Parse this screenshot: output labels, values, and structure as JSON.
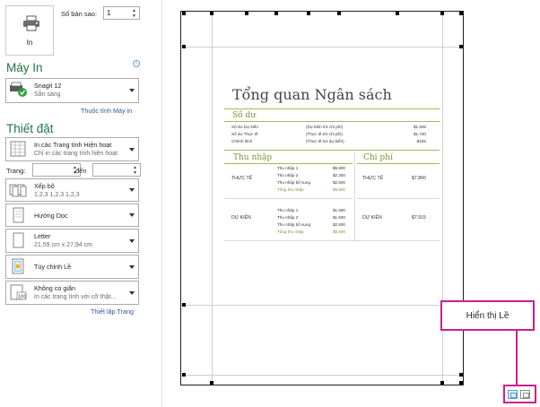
{
  "print": {
    "button_label": "In",
    "copies_label": "Số bản sao:",
    "copies_value": "1"
  },
  "printer": {
    "section_title": "Máy In",
    "info_glyph": "i",
    "name": "Snagit 12",
    "status": "Sẵn sàng",
    "properties_link": "Thuộc tính Máy in"
  },
  "settings": {
    "section_title": "Thiết đặt",
    "scope": {
      "main": "In các Trang tính Hiện hoạt",
      "sub": "Chỉ in các trang tính hiện hoạt"
    },
    "pages_label": "Trang:",
    "to_label": "đến",
    "collate": {
      "main": "Xếp bộ",
      "sub": "1,2,3    1,2,3    1,2,3"
    },
    "orientation": {
      "main": "Hướng Dọc"
    },
    "paper": {
      "main": "Letter",
      "sub": "21,59 cm x 27,94 cm"
    },
    "margins": {
      "main": "Tùy chỉnh Lề"
    },
    "scaling": {
      "main": "Không co giãn",
      "sub": "In các trang tính với cỡ thật..."
    },
    "page_setup_link": "Thiết lập Trang"
  },
  "document": {
    "title": "Tổng quan Ngân sách",
    "balance": {
      "heading": "Số dư",
      "rows": [
        {
          "label": "Số dư Dự kiến",
          "note": "(Dự kiến trừ chi phí)",
          "value": "$1.505"
        },
        {
          "label": "Số dư Thực tế",
          "note": "(Thực tế trừ chi phí)",
          "value": "$1.740"
        },
        {
          "label": "Chênh lệch",
          "note": "(Thực tế trừ dự kiến)",
          "value": "$155"
        }
      ]
    },
    "income": {
      "heading": "Thu nhập",
      "actual": {
        "label": "THỰC TẾ",
        "items": [
          {
            "name": "Thu nhập 1",
            "value": "$5.800"
          },
          {
            "name": "Thu nhập 2",
            "value": "$2.300"
          },
          {
            "name": "Thu nhập bổ sung",
            "value": "$2.500"
          }
        ],
        "total_name": "Tổng thu nhập",
        "total_value": "$9.600"
      },
      "planned": {
        "label": "DỰ KIẾN",
        "items": [
          {
            "name": "Thu nhập 1",
            "value": "$1.500"
          },
          {
            "name": "Thu nhập 2",
            "value": "$1.500"
          },
          {
            "name": "Thu nhập bổ sung",
            "value": "$2.500"
          }
        ],
        "total_name": "Tổng thu nhập",
        "total_value": "$9.500"
      }
    },
    "expenses": {
      "heading": "Chi phí",
      "actual": {
        "label": "THỰC TẾ",
        "value": "$7.860"
      },
      "planned": {
        "label": "DỰ KIẾN",
        "value": "$7.915"
      }
    }
  },
  "callout": {
    "text": "Hiển thị Lề"
  },
  "colors": {
    "accent_green": "#217346",
    "link_blue": "#2b579a",
    "callout_magenta": "#cc1f8e",
    "doc_green": "#77933c"
  }
}
